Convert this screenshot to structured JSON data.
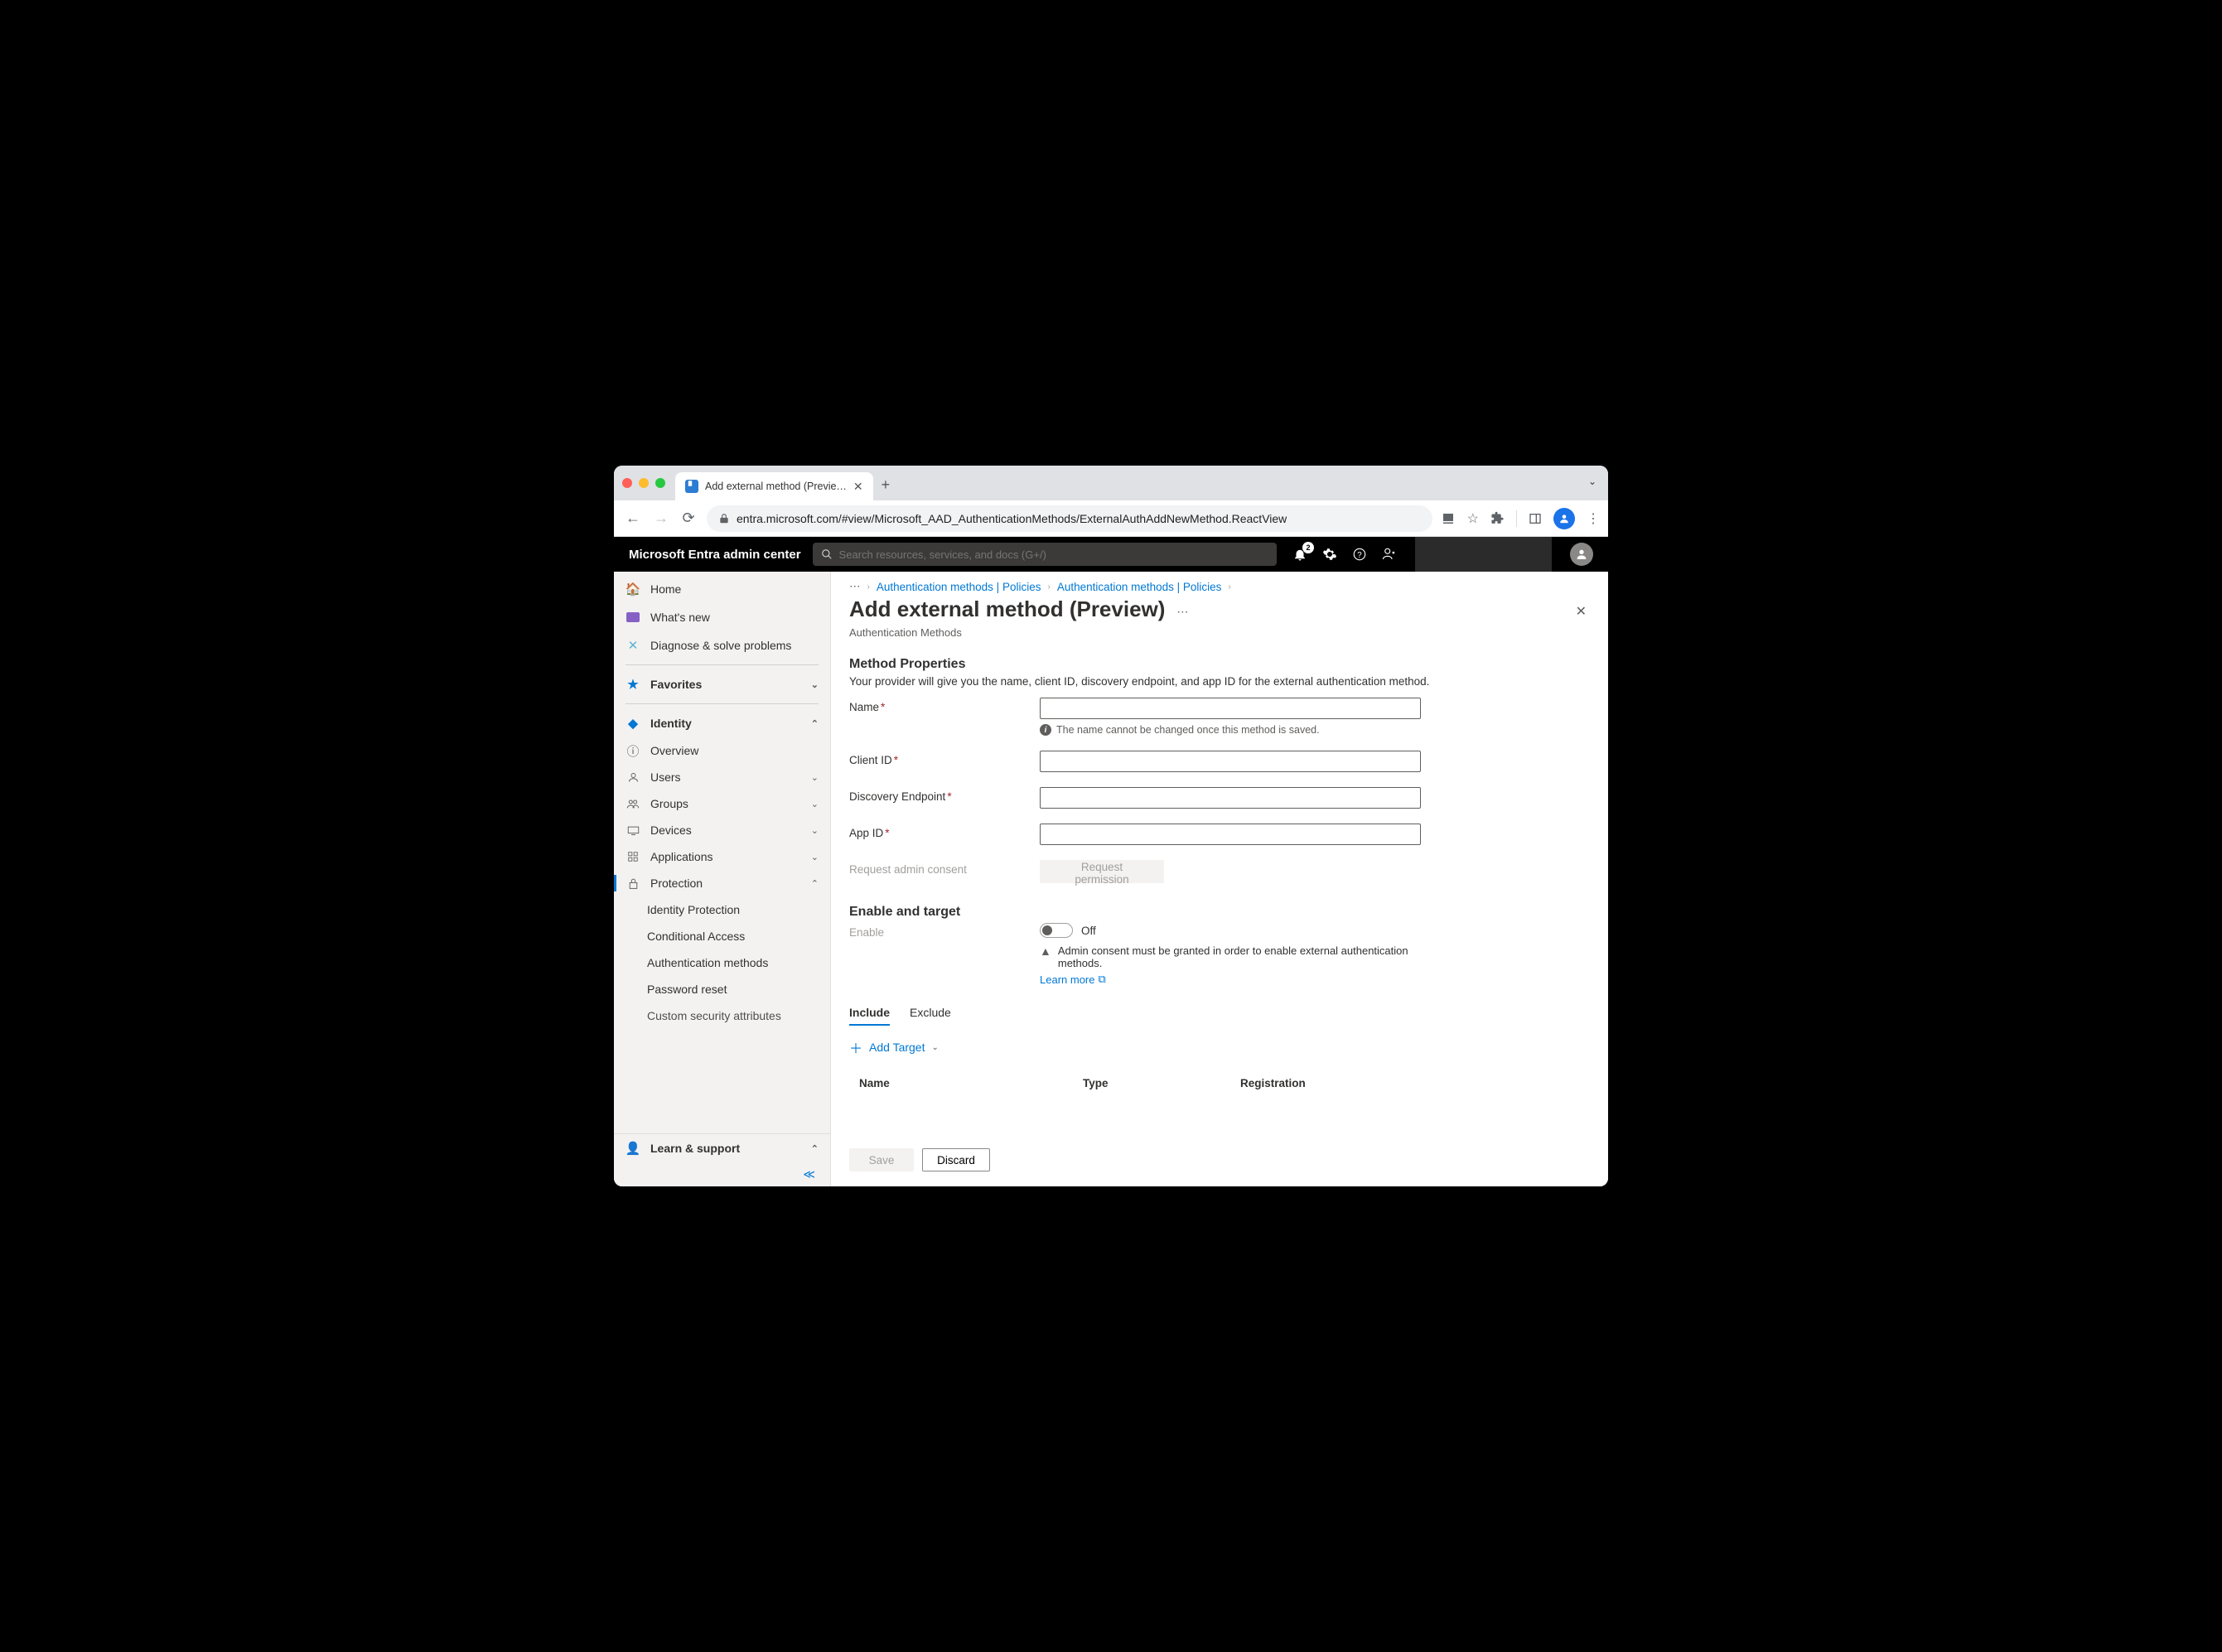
{
  "browser": {
    "tab_title": "Add external method (Previe…",
    "url": "entra.microsoft.com/#view/Microsoft_AAD_AuthenticationMethods/ExternalAuthAddNewMethod.ReactView"
  },
  "topbar": {
    "brand": "Microsoft Entra admin center",
    "search_placeholder": "Search resources, services, and docs (G+/)",
    "notification_count": "2"
  },
  "sidebar": {
    "home": "Home",
    "whats_new": "What's new",
    "diagnose": "Diagnose & solve problems",
    "favorites": "Favorites",
    "identity": "Identity",
    "overview": "Overview",
    "users": "Users",
    "groups": "Groups",
    "devices": "Devices",
    "applications": "Applications",
    "protection": "Protection",
    "identity_protection": "Identity Protection",
    "conditional_access": "Conditional Access",
    "auth_methods": "Authentication methods",
    "password_reset": "Password reset",
    "custom_sec": "Custom security attributes",
    "learn_support": "Learn & support"
  },
  "breadcrumbs": {
    "b1": "Authentication methods | Policies",
    "b2": "Authentication methods | Policies"
  },
  "page": {
    "title": "Add external method (Preview)",
    "subtitle": "Authentication Methods",
    "section1": "Method Properties",
    "section1_desc": "Your provider will give you the name, client ID, discovery endpoint, and app ID for the external authentication method.",
    "name_label": "Name",
    "name_hint": "The name cannot be changed once this method is saved.",
    "client_label": "Client ID",
    "discovery_label": "Discovery Endpoint",
    "appid_label": "App ID",
    "consent_label": "Request admin consent",
    "request_btn": "Request permission",
    "section2": "Enable and target",
    "enable_label": "Enable",
    "enable_value": "Off",
    "enable_warn": "Admin consent must be granted in order to enable external authentication methods.",
    "learn_more": "Learn more",
    "tab_include": "Include",
    "tab_exclude": "Exclude",
    "add_target": "Add Target",
    "th_name": "Name",
    "th_type": "Type",
    "th_reg": "Registration",
    "save": "Save",
    "discard": "Discard"
  }
}
